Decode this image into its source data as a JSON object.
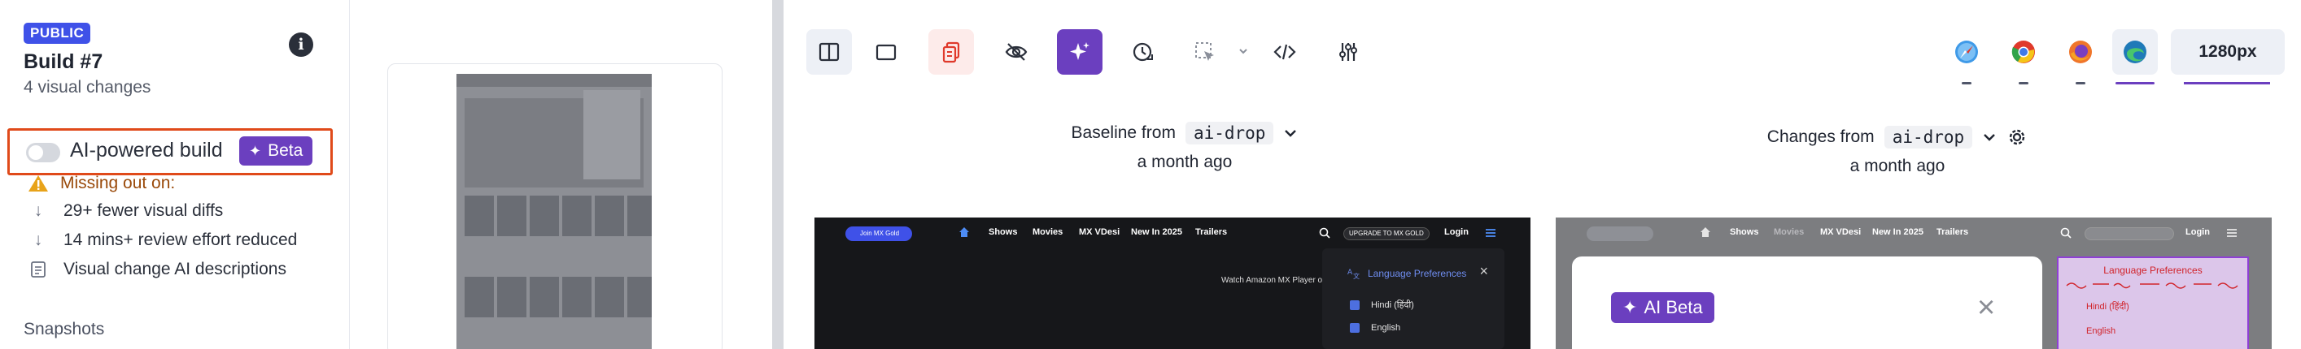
{
  "sidebar": {
    "visibility_badge": "PUBLIC",
    "build_title": "Build #7",
    "build_subtitle": "4 visual changes",
    "info_icon": "i",
    "ai_build_label": "AI-powered build",
    "beta_label": "Beta",
    "missing_label": "Missing out on:",
    "benefits": [
      {
        "icon": "arrow-down-icon",
        "text": "29+ fewer visual diffs"
      },
      {
        "icon": "arrow-down-icon",
        "text": "14 mins+ review effort reduced"
      },
      {
        "icon": "document-icon",
        "text": "Visual change AI descriptions"
      }
    ],
    "snapshots_label": "Snapshots"
  },
  "toolbar": {
    "buttons": [
      "split-view-icon",
      "single-view-icon",
      "copy-diff-icon",
      "hide-icon",
      "ai-sparkle-icon",
      "history-icon",
      "region-select-icon",
      "code-icon",
      "settings-sliders-icon"
    ],
    "browsers": [
      "safari-icon",
      "chrome-icon",
      "firefox-icon",
      "edge-icon"
    ],
    "resolution": "1280px"
  },
  "baseline": {
    "prefix": "Baseline from",
    "branch": "ai-drop",
    "time": "a month ago"
  },
  "changes": {
    "prefix": "Changes from",
    "branch": "ai-drop",
    "time": "a month ago"
  },
  "screenshot_base": {
    "logo_pill": "Join MX Gold",
    "nav": [
      "Shows",
      "Movies",
      "MX VDesi",
      "New In 2025",
      "Trailers"
    ],
    "upgrade": "UPGRADE TO MX GOLD",
    "login": "Login",
    "promo": "Watch Amazon MX Player on",
    "lang_title": "Language Preferences",
    "lang_options": [
      "Hindi (हिंदी)",
      "English"
    ],
    "close": "×"
  },
  "screenshot_change": {
    "nav": [
      "Shows",
      "Movies",
      "MX VDesi",
      "New In 2025",
      "Trailers"
    ],
    "login": "Login",
    "ai_pill": "AI Beta",
    "close": "×",
    "lang_title": "Language Preferences",
    "lang_options": [
      "Hindi (हिंदी)",
      "English"
    ]
  },
  "colors": {
    "accent_purple": "#6b3fbf",
    "public_badge": "#3f51e8",
    "highlight_border": "#e04a1a",
    "warning": "#e8a31a"
  }
}
